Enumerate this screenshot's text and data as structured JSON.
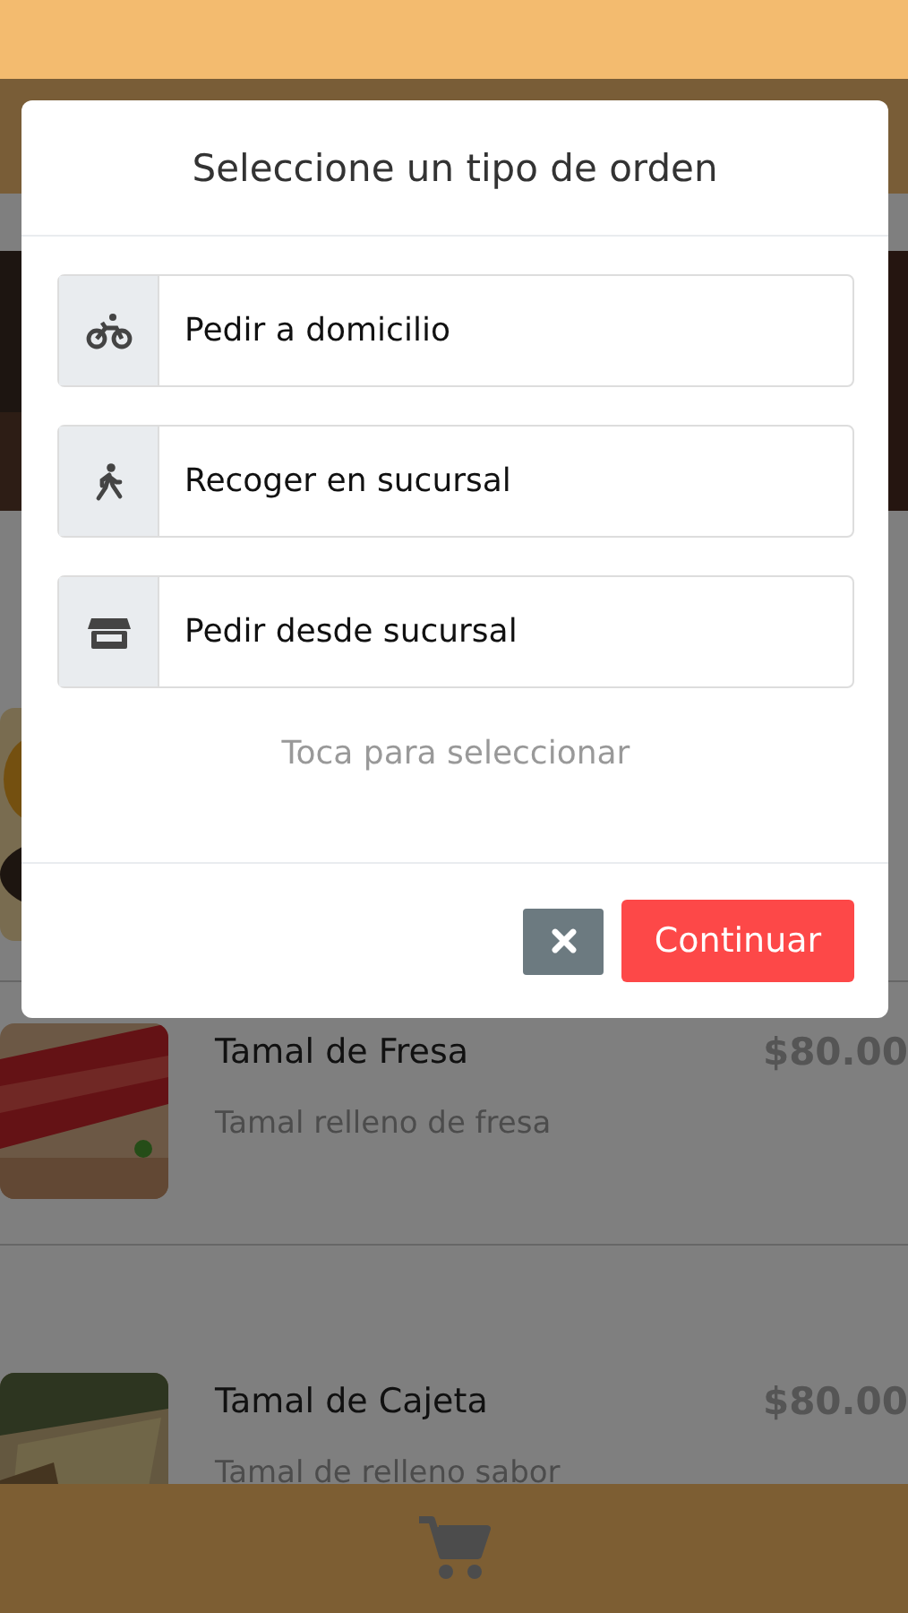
{
  "modal": {
    "title": "Seleccione un tipo de orden",
    "options": [
      {
        "kind": "bike",
        "label": "Pedir a domicilio",
        "selected": false
      },
      {
        "kind": "walk",
        "label": "Recoger en sucursal",
        "selected": false
      },
      {
        "kind": "store",
        "label": "Pedir desde sucursal",
        "selected": false
      }
    ],
    "hint": "Toca para seleccionar",
    "continue_button": "Continuar"
  },
  "products": [
    {
      "kind": "picture"
    },
    {
      "name": "Tamal de Fresa",
      "description": "Tamal relleno de fresa",
      "price": "$80.00"
    },
    {
      "name": "Tamal de Cajeta",
      "description": "Tamal de relleno sabor",
      "price": "$80.00"
    }
  ]
}
